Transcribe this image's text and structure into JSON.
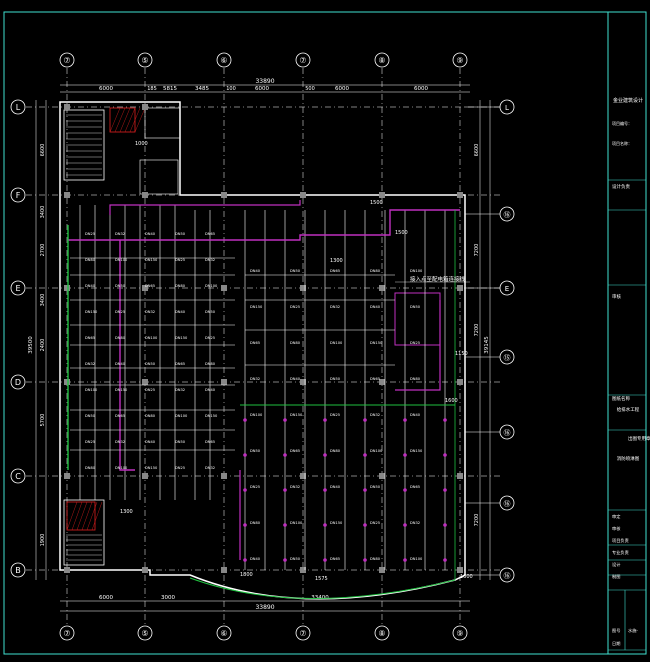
{
  "drawing": {
    "grid_columns": [
      "⑦",
      "⑤",
      "⑥",
      "⑦",
      "⑧",
      "⑨"
    ],
    "grid_rows_left": [
      "L",
      "F",
      "E",
      "D",
      "C",
      "B"
    ],
    "grid_rows_right": [
      "L",
      "⑯",
      "E",
      "⑮",
      "⑯",
      "⑯",
      "⑯"
    ],
    "top_overall_dim": "33890",
    "top_dims": [
      "6000",
      "5815",
      "3485",
      "6000",
      "6000",
      "6000"
    ],
    "top_small_dims": [
      "185",
      "100",
      "500"
    ],
    "bottom_overall_dim": "33890",
    "bottom_dims": [
      "6000",
      "3000",
      "33400"
    ],
    "left_overall_dim": "39500",
    "left_dims": [
      "6600",
      "3400",
      "2700",
      "3400",
      "2400",
      "5700",
      "1900"
    ],
    "right_overall_dim": "39145",
    "right_dims": [
      "6600",
      "7200",
      "7200",
      "7200"
    ],
    "plan_labels": [
      "1500",
      "1300",
      "1500",
      "1600",
      "1150",
      "1300",
      "1600",
      "1800",
      "1575",
      "1000"
    ],
    "annotation_text": "接入点至配电箱连接线",
    "pipe_labels": [
      "DN25",
      "DN32",
      "DN40",
      "DN50",
      "DN65",
      "DN80",
      "DN100",
      "DN150"
    ]
  },
  "title_block": {
    "company": "金业建筑设计",
    "project_label_1": "项目编号：",
    "project_label_2": "项目名称：",
    "design_section": "设计负责",
    "review_section": "审核",
    "drawing_name_label": "图纸名称",
    "drawing_name": "给排水工程",
    "drawing_sub": "消防喷淋图",
    "stamp_label": "出图专用章",
    "rows": [
      "审定",
      "审核",
      "项目负责",
      "专业负责",
      "设计",
      "制图"
    ],
    "bottom_label_1": "图号",
    "bottom_label_2": "日期",
    "bottom_value": "水施-"
  },
  "colors": {
    "background": "#000000",
    "grid_line": "#ffffff",
    "wall": "#ffffff",
    "pipe_main": "#c030c0",
    "pipe_branch": "#ffffff",
    "green": "#20c040",
    "red": "#e02020",
    "border": "#40e0d0",
    "axis_circle": "#ffffff"
  }
}
